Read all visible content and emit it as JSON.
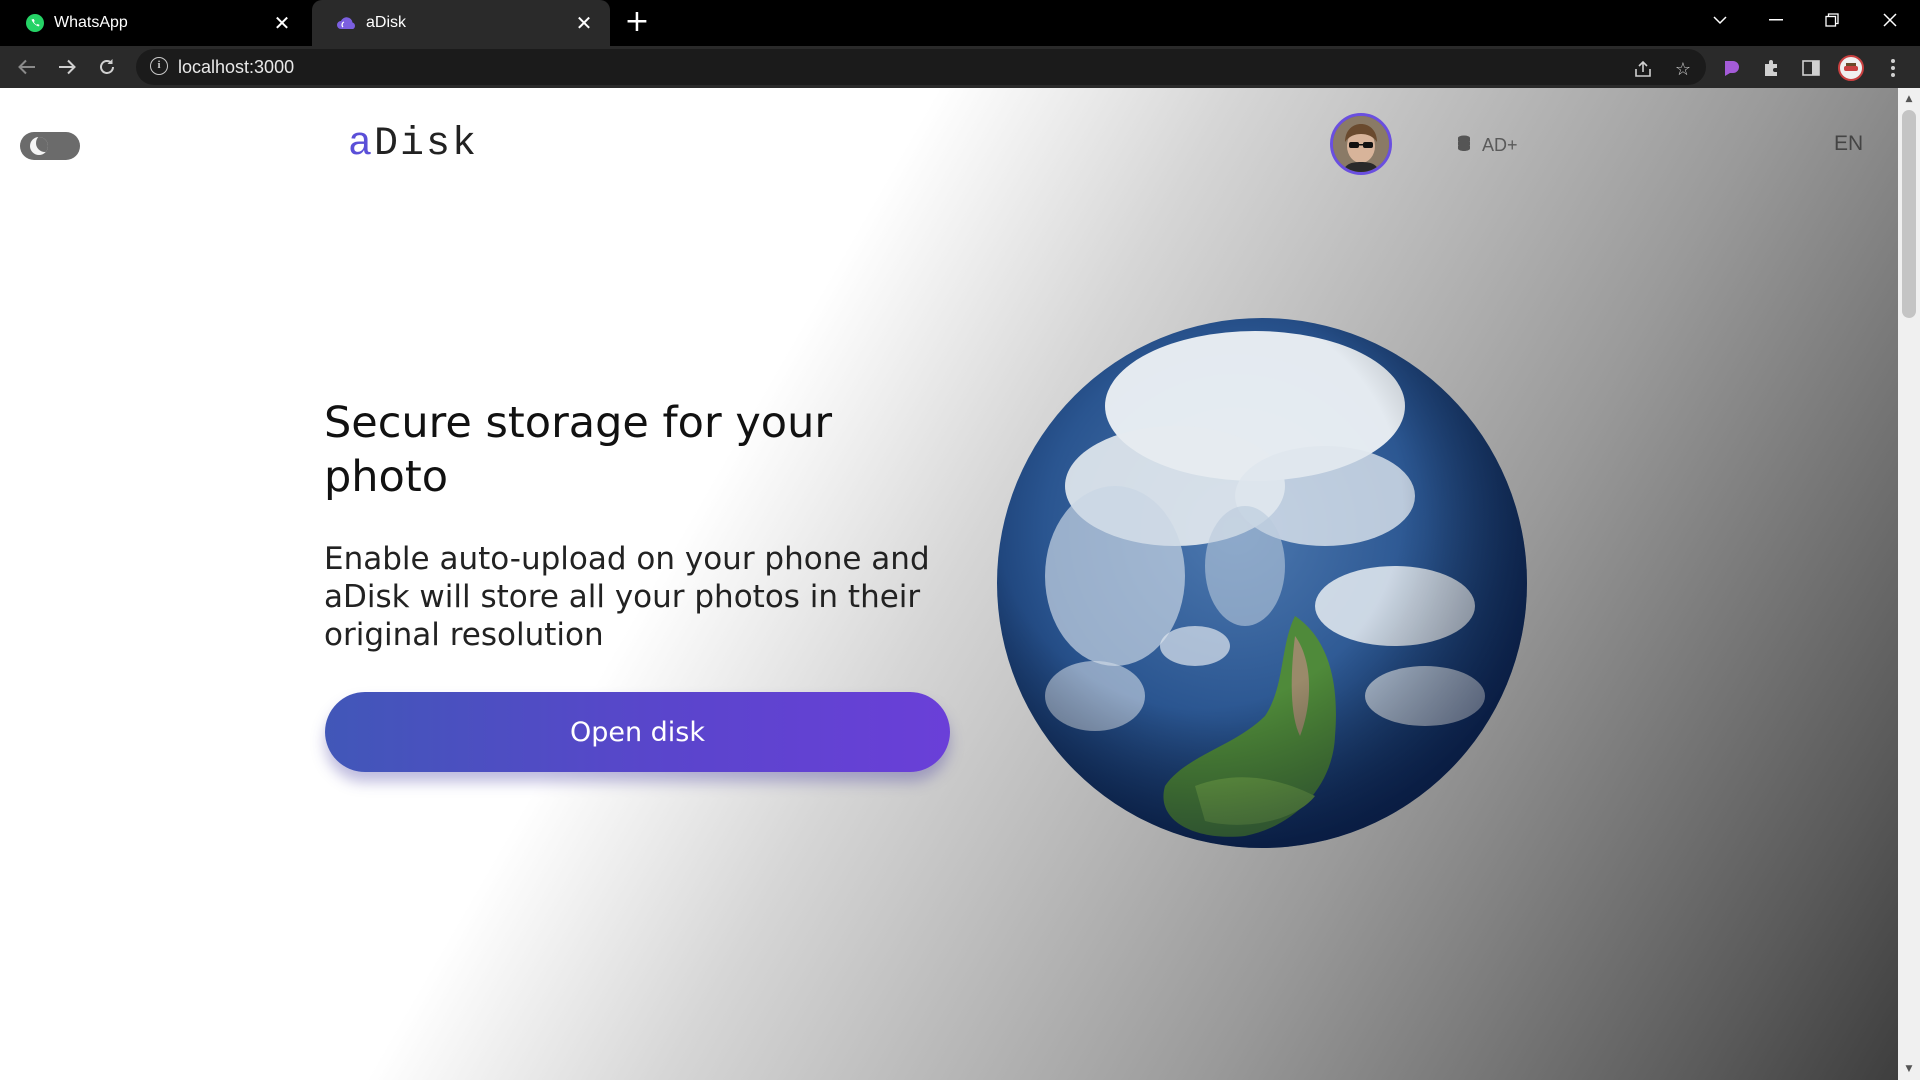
{
  "browser": {
    "tabs": [
      {
        "title": "WhatsApp",
        "icon": "whatsapp-icon",
        "active": false
      },
      {
        "title": "aDisk",
        "icon": "cloud-icon",
        "active": true
      }
    ],
    "url": "localhost:3000"
  },
  "page": {
    "logo": {
      "accent": "a",
      "rest": "Disk"
    },
    "plus_label": "AD+",
    "language": "EN",
    "hero": {
      "title": "Secure storage for your photo",
      "subtitle": "Enable auto-upload on your phone and aDisk will store all your photos in their original resolution",
      "cta": "Open disk"
    }
  },
  "colors": {
    "accent": "#5a4fd8",
    "cta_start": "#4157b8",
    "cta_end": "#6a3fd8"
  }
}
